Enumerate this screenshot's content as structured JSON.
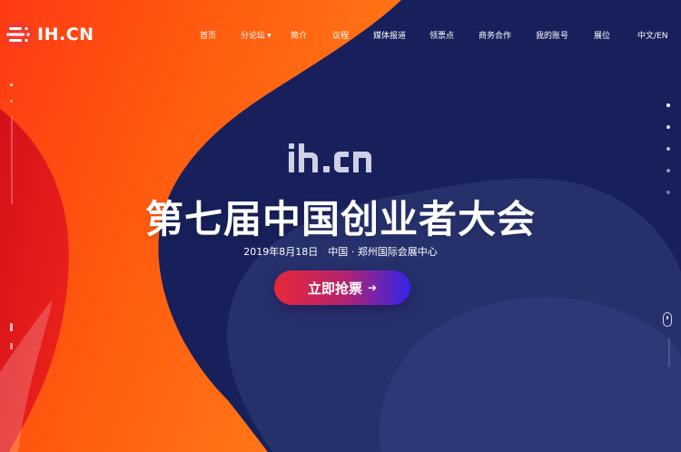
{
  "brand": {
    "logo_text": "IH.CN",
    "hero_logo_text": "ih.cn"
  },
  "nav": {
    "items": [
      {
        "label": "首页"
      },
      {
        "label": "分论坛",
        "has_dropdown": true
      },
      {
        "label": "简介"
      },
      {
        "label": "议程"
      },
      {
        "label": "媒体报道"
      },
      {
        "label": "领票点"
      },
      {
        "label": "商务合作"
      },
      {
        "label": "我的账号"
      },
      {
        "label": "展位"
      },
      {
        "label": "中文/EN"
      }
    ]
  },
  "hero": {
    "title": "第七届中国创业者大会",
    "subtitle": "2019年8月18日　中国 · 郑州国际会展中心",
    "cta_label": "立即抢票",
    "cta_arrow": "➔"
  },
  "colors": {
    "navy": "#17205a",
    "mid_blue": "#27336e",
    "orange": "#ff6a10",
    "red": "#e11a1a",
    "cta_start": "#e6283a",
    "cta_end": "#3324ea"
  },
  "icons": {
    "logo": "ih-cn-logo-icon",
    "dropdown": "caret-down-icon",
    "cta_arrow": "arrow-right-icon",
    "scroll": "mouse-scroll-icon",
    "slide_dots": "pagination-dot-icon"
  },
  "slider": {
    "slide_count": 5,
    "active_slide": 1
  }
}
